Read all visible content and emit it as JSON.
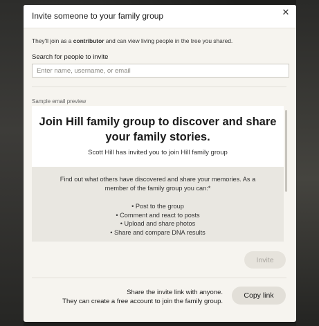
{
  "dialog": {
    "title": "Invite someone to your family group",
    "close_icon": "close-icon",
    "intro_prefix": "They'll join as a ",
    "intro_role": "contributor",
    "intro_suffix": " and can view living people in the tree you shared."
  },
  "search": {
    "label": "Search for people to invite",
    "placeholder": "Enter name, username, or email",
    "value": ""
  },
  "preview": {
    "label": "Sample email preview",
    "heading": "Join Hill family group to discover and share your family stories.",
    "subheading": "Scott Hill has invited you to join Hill family group",
    "body": "Find out what others have discovered and share your memories. As a member of the family group you can:*",
    "items": [
      "• Post to the group",
      "• Comment and react to posts",
      "• Upload and share photos",
      "• Share and compare DNA results"
    ]
  },
  "actions": {
    "invite_label": "Invite",
    "invite_enabled": false,
    "share_line_1": "Share the invite link with anyone.",
    "share_line_2": "They can create a free account to join the family group.",
    "copy_label": "Copy link"
  },
  "colors": {
    "modal_background": "#f6f4ef",
    "disabled_button": "#e6e3dc",
    "secondary_button": "#e2dfd8"
  }
}
